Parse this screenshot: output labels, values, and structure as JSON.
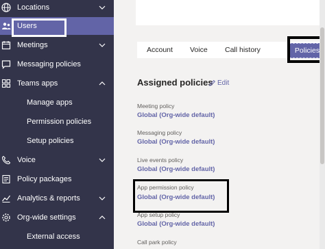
{
  "sidebar": {
    "items": [
      {
        "label": "Locations",
        "icon": "globe-icon",
        "chevron": "down"
      },
      {
        "label": "Users",
        "icon": "users-icon",
        "active": true
      },
      {
        "label": "Meetings",
        "icon": "calendar-icon",
        "chevron": "down"
      },
      {
        "label": "Messaging policies",
        "icon": "chat-icon"
      },
      {
        "label": "Teams apps",
        "icon": "apps-icon",
        "chevron": "up"
      },
      {
        "label": "Manage apps",
        "sub": true
      },
      {
        "label": "Permission policies",
        "sub": true
      },
      {
        "label": "Setup policies",
        "sub": true
      },
      {
        "label": "Voice",
        "icon": "phone-icon",
        "chevron": "down"
      },
      {
        "label": "Policy packages",
        "icon": "package-icon"
      },
      {
        "label": "Analytics & reports",
        "icon": "chart-icon",
        "chevron": "down"
      },
      {
        "label": "Org-wide settings",
        "icon": "gear-icon",
        "chevron": "up"
      },
      {
        "label": "External access",
        "sub": true
      }
    ]
  },
  "tabs": [
    {
      "label": "Account"
    },
    {
      "label": "Voice"
    },
    {
      "label": "Call history"
    },
    {
      "label": "Policies",
      "active": true
    }
  ],
  "assigned": {
    "title": "Assigned policies",
    "edit_label": "Edit",
    "policies": [
      {
        "label": "Meeting policy",
        "value": "Global (Org-wide default)"
      },
      {
        "label": "Messaging policy",
        "value": "Global (Org-wide default)"
      },
      {
        "label": "Live events policy",
        "value": "Global (Org-wide default)"
      },
      {
        "label": "App permission policy",
        "value": "Global (Org-wide default)"
      },
      {
        "label": "App setup policy",
        "value": "Global (Org-wide default)"
      },
      {
        "label": "Call park policy",
        "value": ""
      }
    ]
  },
  "colors": {
    "sidebar_bg": "#33344a",
    "accent": "#6264a7",
    "content_bg": "#f3f2f1"
  }
}
